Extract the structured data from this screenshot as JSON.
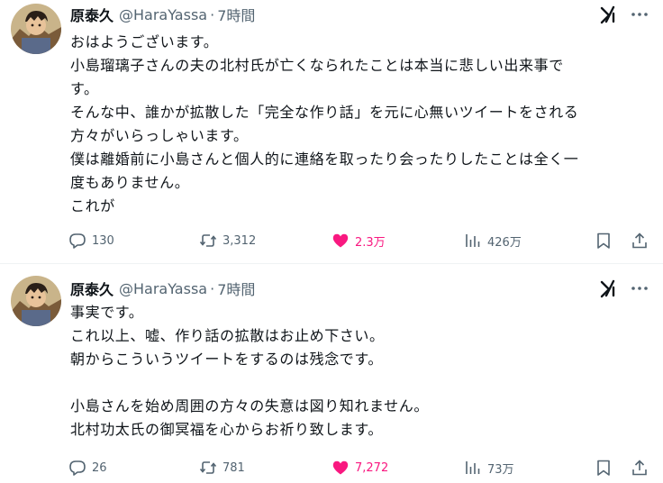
{
  "tweets": [
    {
      "display_name": "原泰久",
      "handle": "@HaraYassa",
      "separator": "·",
      "time": "7時間",
      "body_lines": [
        "おはようございます。",
        "小島瑠璃子さんの夫の北村氏が亡くなられたことは本当に悲しい出来事で",
        "す。",
        "そんな中、誰かが拡散した「完全な作り話」を元に心無いツイートをされる",
        "方々がいらっしゃいます。",
        "僕は離婚前に小島さんと個人的に連絡を取ったり会ったりしたことは全く一",
        "度もありません。",
        "これが"
      ],
      "replies": "130",
      "retweets": "3,312",
      "likes": "2.3万",
      "views": "426万",
      "liked": true
    },
    {
      "display_name": "原泰久",
      "handle": "@HaraYassa",
      "separator": "·",
      "time": "7時間",
      "body_lines": [
        "事実です。",
        "これ以上、嘘、作り話の拡散はお止め下さい。",
        "朝からこういうツイートをするのは残念です。",
        "",
        "小島さんを始め周囲の方々の失意は図り知れません。",
        "北村功太氏の御冥福を心からお祈り致します。"
      ],
      "replies": "26",
      "retweets": "781",
      "likes": "7,272",
      "views": "73万",
      "liked": true
    }
  ],
  "icons": {
    "reply": "reply-icon",
    "retweet": "retweet-icon",
    "like": "heart-icon",
    "views": "views-chart-icon",
    "bookmark": "bookmark-icon",
    "share": "share-icon",
    "grok": "grok-icon",
    "more": "more-icon"
  },
  "colors": {
    "text": "#0f1419",
    "secondary": "#536471",
    "like": "#f91880",
    "divider": "#eff3f4"
  }
}
